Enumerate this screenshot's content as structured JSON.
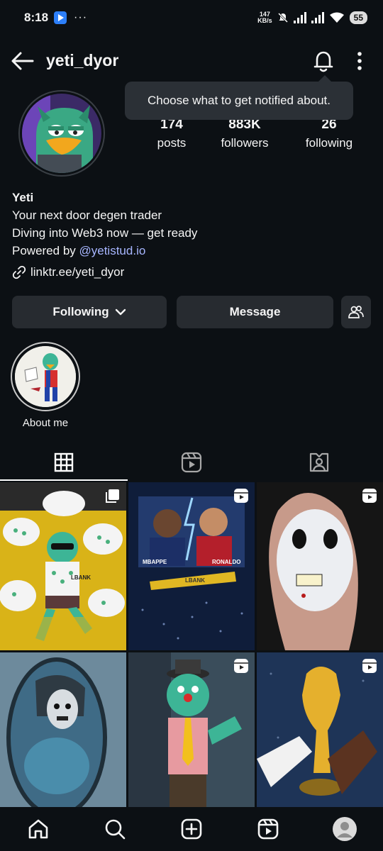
{
  "status_bar": {
    "time": "8:18",
    "dots": "···",
    "speed_top": "147",
    "speed_unit": "KB/s",
    "battery": "55"
  },
  "header": {
    "username": "yeti_dyor"
  },
  "tooltip": {
    "text": "Choose what to get notified about."
  },
  "stats": [
    {
      "value": "174",
      "label": "posts"
    },
    {
      "value": "883K",
      "label": "followers"
    },
    {
      "value": "26",
      "label": "following"
    }
  ],
  "bio": {
    "name": "Yeti",
    "line1": "Your next door degen trader",
    "line2": "Diving into Web3 now — get ready",
    "powered_prefix": "Powered by ",
    "mention": "@yetistud.io",
    "link": "linktr.ee/yeti_dyor"
  },
  "actions": {
    "following_label": "Following",
    "message_label": "Message"
  },
  "highlight": {
    "label": "About me"
  },
  "grid_posts": [
    {
      "text": "LBANK"
    },
    {
      "left": "MBAPPE",
      "right": "RONALDO",
      "brand": "LBANK"
    },
    {},
    {},
    {},
    {}
  ],
  "colors": {
    "background": "#0c1014",
    "button": "#272b30",
    "accent_link": "#a7b6ff"
  }
}
